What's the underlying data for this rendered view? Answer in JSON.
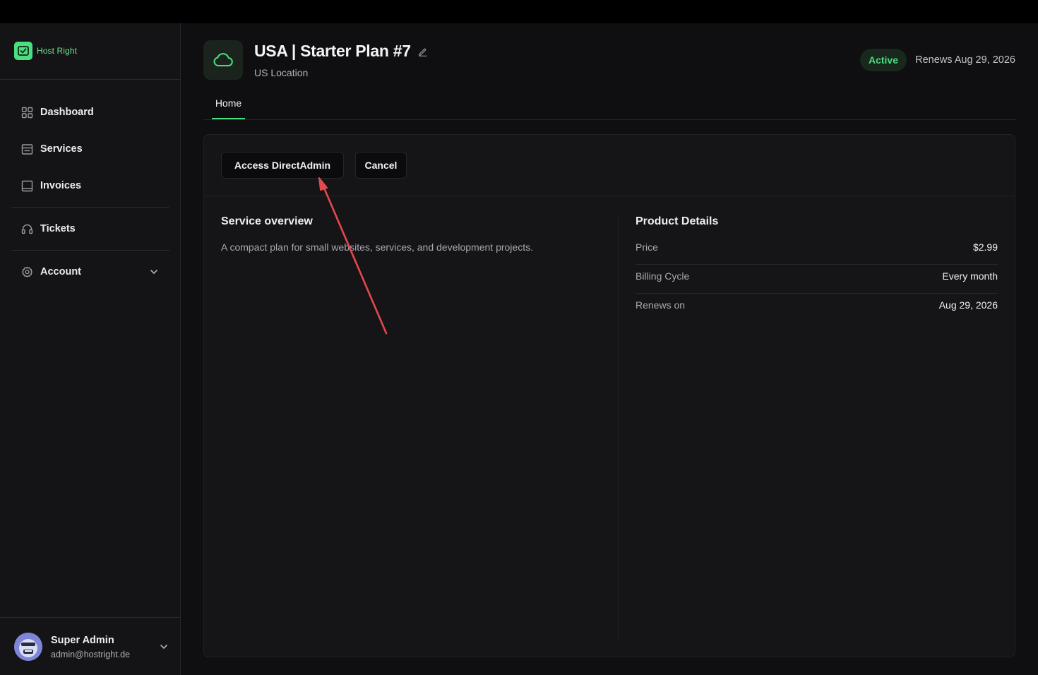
{
  "brand": {
    "name": "Host Right"
  },
  "sidebar": {
    "items": [
      {
        "label": "Dashboard",
        "icon": "grid-icon"
      },
      {
        "label": "Services",
        "icon": "server-icon"
      },
      {
        "label": "Invoices",
        "icon": "invoice-icon"
      },
      {
        "label": "Tickets",
        "icon": "headset-icon"
      },
      {
        "label": "Account",
        "icon": "gear-icon"
      }
    ]
  },
  "user": {
    "name": "Super Admin",
    "email": "admin@hostright.de"
  },
  "service": {
    "title": "USA | Starter Plan #7",
    "subtitle": "US Location",
    "status": "Active",
    "renews_text": "Renews Aug 29, 2026"
  },
  "tabs": [
    {
      "label": "Home",
      "active": true
    }
  ],
  "actions": {
    "access_label": "Access DirectAdmin",
    "cancel_label": "Cancel"
  },
  "overview": {
    "title": "Service overview",
    "description": "A compact plan for small websites, services, and development projects."
  },
  "details": {
    "title": "Product Details",
    "rows": [
      {
        "label": "Price",
        "value": "$2.99"
      },
      {
        "label": "Billing Cycle",
        "value": "Every month"
      },
      {
        "label": "Renews on",
        "value": "Aug 29, 2026"
      }
    ]
  },
  "colors": {
    "accent": "#4ade80",
    "annotation": "#e5484d",
    "background": "#0f0f11"
  }
}
